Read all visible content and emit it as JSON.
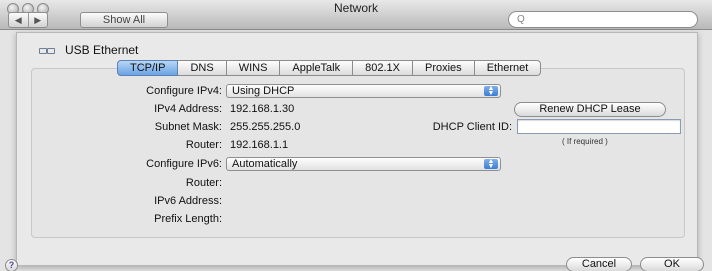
{
  "window": {
    "title": "Network"
  },
  "toolbar": {
    "show_all_label": "Show All",
    "nav_back": "◀",
    "nav_forward": "▶",
    "search_icon": "Q"
  },
  "interface": {
    "name": "USB Ethernet"
  },
  "tabs": [
    {
      "label": "TCP/IP",
      "active": true
    },
    {
      "label": "DNS"
    },
    {
      "label": "WINS"
    },
    {
      "label": "AppleTalk"
    },
    {
      "label": "802.1X"
    },
    {
      "label": "Proxies"
    },
    {
      "label": "Ethernet"
    }
  ],
  "ipv4": {
    "configure_label": "Configure IPv4:",
    "configure_value": "Using DHCP",
    "address_label": "IPv4 Address:",
    "address_value": "192.168.1.30",
    "subnet_label": "Subnet Mask:",
    "subnet_value": "255.255.255.0",
    "router_label": "Router:",
    "router_value": "192.168.1.1",
    "renew_button": "Renew DHCP Lease",
    "client_id_label": "DHCP Client ID:",
    "client_id_value": "",
    "client_id_hint": "( If required )"
  },
  "ipv6": {
    "configure_label": "Configure IPv6:",
    "configure_value": "Automatically",
    "router_label": "Router:",
    "address_label": "IPv6 Address:",
    "prefix_label": "Prefix Length:"
  },
  "footer": {
    "help_label": "?",
    "cancel_label": "Cancel",
    "ok_label": "OK"
  }
}
